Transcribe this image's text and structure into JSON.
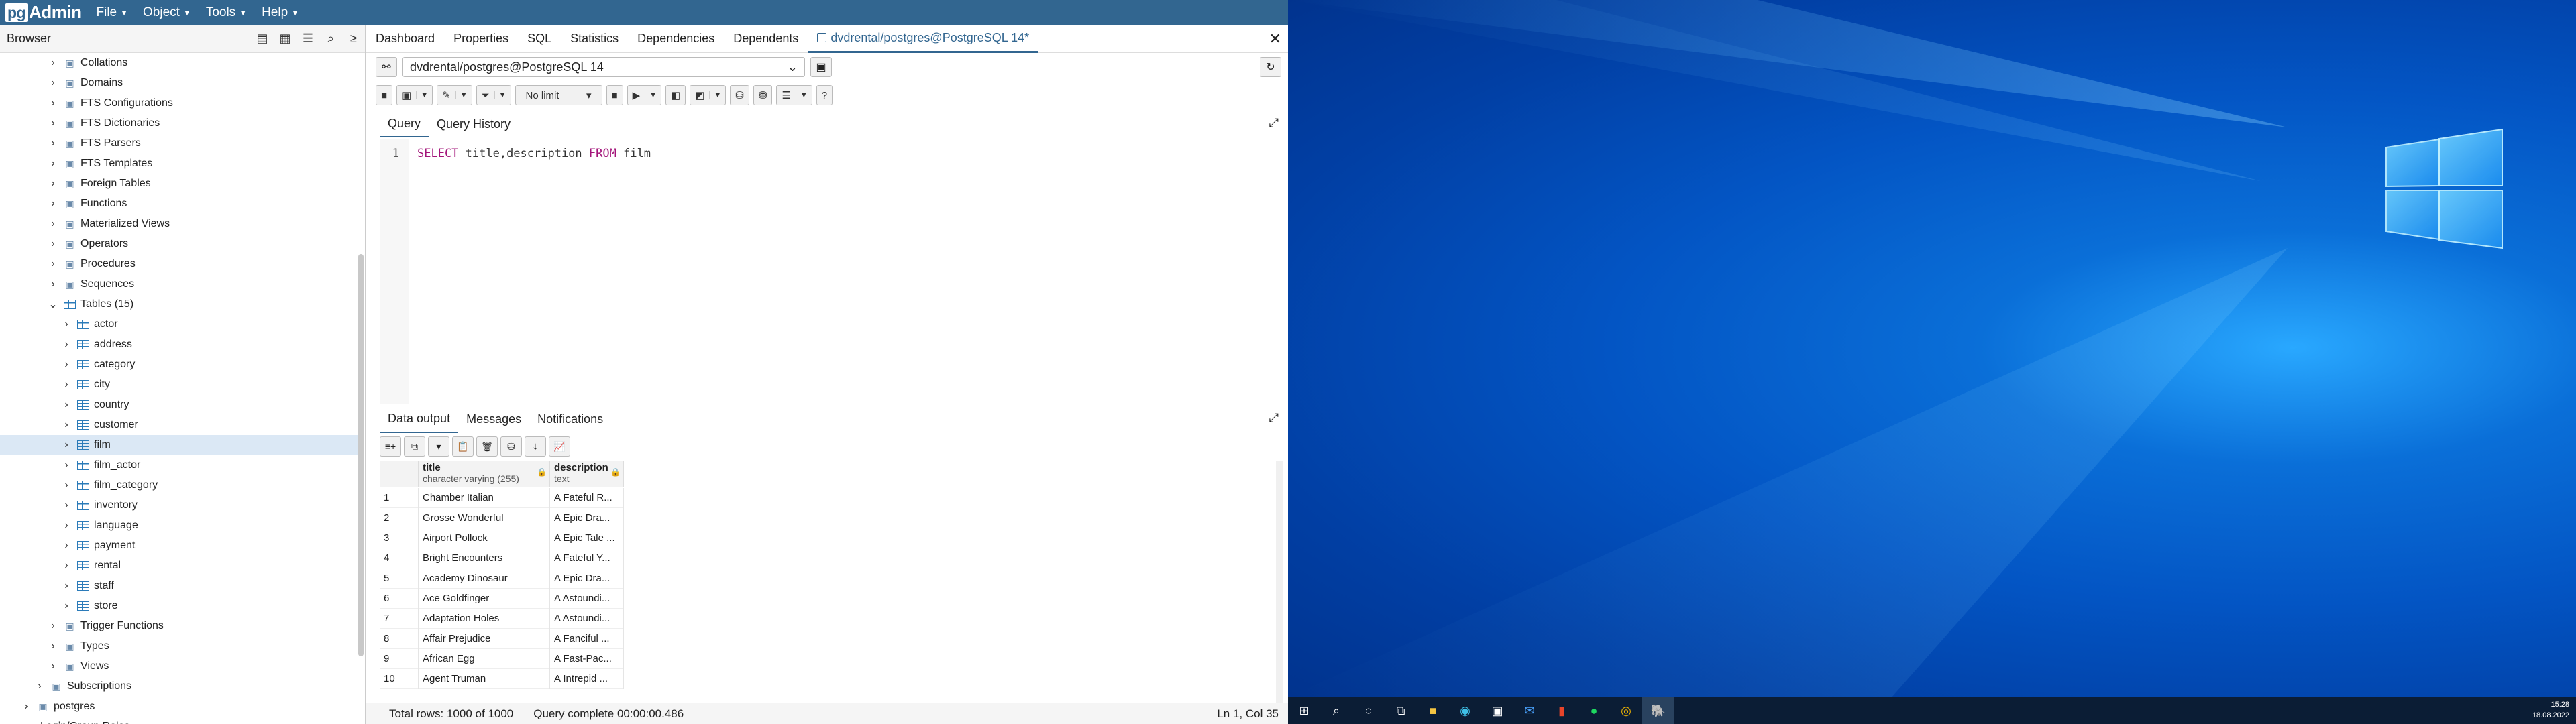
{
  "app": {
    "logo_pg": "pg",
    "logo_rest": "Admin",
    "menus": [
      "File",
      "Object",
      "Tools",
      "Help"
    ]
  },
  "browser": {
    "title": "Browser",
    "tree": [
      {
        "label": "Collations",
        "icon": "collation-icon",
        "arrow": "›"
      },
      {
        "label": "Domains",
        "icon": "domain-icon",
        "arrow": "›"
      },
      {
        "label": "FTS Configurations",
        "icon": "fts-config-icon",
        "arrow": "›"
      },
      {
        "label": "FTS Dictionaries",
        "icon": "fts-dictionary-icon",
        "arrow": "›"
      },
      {
        "label": "FTS Parsers",
        "icon": "fts-parser-icon",
        "arrow": "›"
      },
      {
        "label": "FTS Templates",
        "icon": "fts-template-icon",
        "arrow": "›"
      },
      {
        "label": "Foreign Tables",
        "icon": "foreign-table-icon",
        "arrow": "›"
      },
      {
        "label": "Functions",
        "icon": "function-icon",
        "arrow": "›"
      },
      {
        "label": "Materialized Views",
        "icon": "materialized-view-icon",
        "arrow": "›"
      },
      {
        "label": "Operators",
        "icon": "operator-icon",
        "arrow": "›"
      },
      {
        "label": "Procedures",
        "icon": "procedure-icon",
        "arrow": "›"
      },
      {
        "label": "Sequences",
        "icon": "sequence-icon",
        "arrow": "›"
      },
      {
        "label": "Tables (15)",
        "icon": "tables-icon",
        "arrow": "⌄"
      }
    ],
    "tables": [
      "actor",
      "address",
      "category",
      "city",
      "country",
      "customer",
      "film",
      "film_actor",
      "film_category",
      "inventory",
      "language",
      "payment",
      "rental",
      "staff",
      "store"
    ],
    "after": [
      {
        "label": "Trigger Functions",
        "icon": "trigger-function-icon"
      },
      {
        "label": "Types",
        "icon": "type-icon"
      },
      {
        "label": "Views",
        "icon": "view-icon"
      }
    ],
    "subscriptions": "Subscriptions",
    "postgres": "postgres",
    "login_roles": "Login/Group Roles"
  },
  "tabs": [
    "Dashboard",
    "Properties",
    "SQL",
    "Statistics",
    "Dependencies",
    "Dependents",
    "dvdrental/postgres@PostgreSQL 14*"
  ],
  "connection": "dvdrental/postgres@PostgreSQL 14",
  "toolbar": {
    "limit": "No limit"
  },
  "query_tabs": [
    "Query",
    "Query History"
  ],
  "editor": {
    "line": "1",
    "kw1": "SELECT",
    "mid": " title,description ",
    "kw2": "FROM",
    "end": " film"
  },
  "output_tabs": [
    "Data output",
    "Messages",
    "Notifications"
  ],
  "grid": {
    "columns": [
      {
        "name": "title",
        "type": "character varying (255)"
      },
      {
        "name": "description",
        "type": "text"
      }
    ],
    "rows": [
      [
        "1",
        "Chamber Italian",
        "A Fateful R..."
      ],
      [
        "2",
        "Grosse Wonderful",
        "A Epic Dra..."
      ],
      [
        "3",
        "Airport Pollock",
        "A Epic Tale ..."
      ],
      [
        "4",
        "Bright Encounters",
        "A Fateful Y..."
      ],
      [
        "5",
        "Academy Dinosaur",
        "A Epic Dra..."
      ],
      [
        "6",
        "Ace Goldfinger",
        "A Astoundi..."
      ],
      [
        "7",
        "Adaptation Holes",
        "A Astoundi..."
      ],
      [
        "8",
        "Affair Prejudice",
        "A Fanciful ..."
      ],
      [
        "9",
        "African Egg",
        "A Fast-Pac..."
      ],
      [
        "10",
        "Agent Truman",
        "A Intrepid ..."
      ]
    ]
  },
  "status": {
    "rows": "Total rows: 1000 of 1000",
    "time": "Query complete 00:00:00.486",
    "pos": "Ln 1, Col 35"
  },
  "clock": {
    "time": "15:28",
    "date": "18.08.2022"
  }
}
